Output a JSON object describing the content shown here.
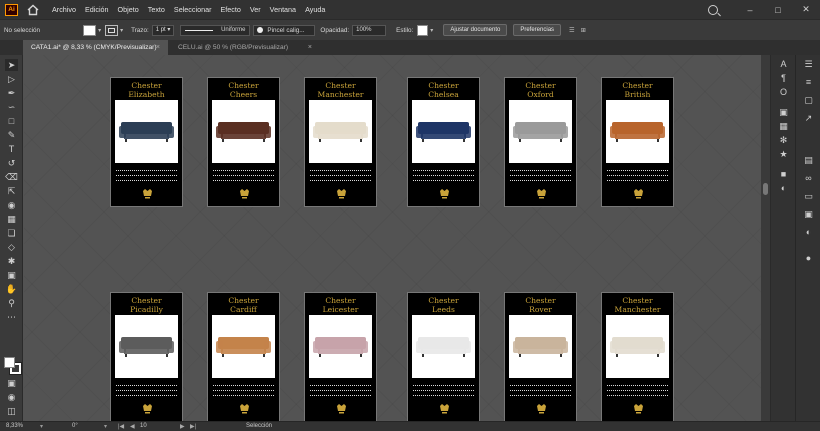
{
  "app": {
    "logo_text": "Ai",
    "menu": [
      "Archivo",
      "Edición",
      "Objeto",
      "Texto",
      "Seleccionar",
      "Efecto",
      "Ver",
      "Ventana",
      "Ayuda"
    ]
  },
  "properties": {
    "selection": "No selección",
    "stroke_label": "Trazo:",
    "stroke_weight": "1 pt",
    "profile": "Uniforme",
    "brush": "Pincel calig...",
    "opacity_label": "Opacidad:",
    "opacity": "100%",
    "style_label": "Estilo:",
    "doc_setup": "Ajustar documento",
    "preferences": "Preferencias"
  },
  "tabs": [
    {
      "label": "CATA1.ai* @ 8,33 % (CMYK/Previsualizar)",
      "close": "×"
    },
    {
      "label": "CELU.ai @ 50 % (RGB/Previsualizar)",
      "close": "×"
    }
  ],
  "status": {
    "zoom": "8,33%",
    "rotation": "0°",
    "artboard_num": "10",
    "mode": "Selección"
  },
  "artboards": [
    {
      "line1": "Chester",
      "line2": "Elizabeth",
      "sofa_color": "#2c3e55"
    },
    {
      "line1": "Chester",
      "line2": "Cheers",
      "sofa_color": "#5a2f22"
    },
    {
      "line1": "Chester",
      "line2": "Manchester",
      "sofa_color": "#e4dccb"
    },
    {
      "line1": "Chester",
      "line2": "Chelsea",
      "sofa_color": "#1e3566"
    },
    {
      "line1": "Chester",
      "line2": "Oxford",
      "sofa_color": "#9a9a9a"
    },
    {
      "line1": "Chester",
      "line2": "British",
      "sofa_color": "#b8642c"
    },
    {
      "line1": "Chester",
      "line2": "Picadilly",
      "sofa_color": "#5c5c5c"
    },
    {
      "line1": "Chester",
      "line2": "Cardiff",
      "sofa_color": "#c4834a"
    },
    {
      "line1": "Chester",
      "line2": "Leicester",
      "sofa_color": "#c7a3aa"
    },
    {
      "line1": "Chester",
      "line2": "Leeds",
      "sofa_color": "#e8e8e8"
    },
    {
      "line1": "Chester",
      "line2": "Rover",
      "sofa_color": "#c9b49c"
    },
    {
      "line1": "Chester",
      "line2": "Manchester",
      "sofa_color": "#e2dccf"
    }
  ],
  "colors": {
    "title_gold": "#c9a33a",
    "accent_orange": "#ff9a00"
  }
}
